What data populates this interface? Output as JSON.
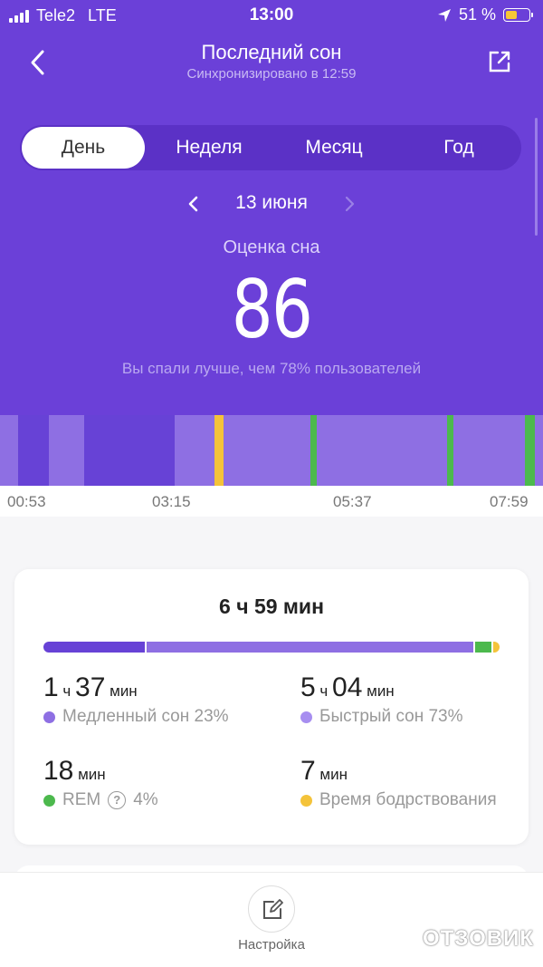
{
  "status_bar": {
    "carrier": "Tele2",
    "network": "LTE",
    "time": "13:00",
    "battery": "51 %"
  },
  "header": {
    "title": "Последний сон",
    "subtitle": "Синхронизировано в 12:59"
  },
  "tabs": [
    {
      "label": "День",
      "active": true
    },
    {
      "label": "Неделя",
      "active": false
    },
    {
      "label": "Месяц",
      "active": false
    },
    {
      "label": "Год",
      "active": false
    }
  ],
  "date_nav": {
    "label": "13 июня"
  },
  "score": {
    "label": "Оценка сна",
    "value": "86",
    "description": "Вы спали лучше, чем 78% пользователей"
  },
  "timeline": {
    "ticks": [
      "00:53",
      "03:15",
      "05:37",
      "07:59"
    ],
    "segments": [
      {
        "stage": "light",
        "start": 0.0,
        "end": 0.033
      },
      {
        "stage": "deep",
        "start": 0.033,
        "end": 0.09
      },
      {
        "stage": "light",
        "start": 0.09,
        "end": 0.155
      },
      {
        "stage": "deep",
        "start": 0.155,
        "end": 0.322
      },
      {
        "stage": "light",
        "start": 0.322,
        "end": 0.395
      },
      {
        "stage": "awake",
        "start": 0.395,
        "end": 0.412
      },
      {
        "stage": "light",
        "start": 0.412,
        "end": 0.572
      },
      {
        "stage": "rem",
        "start": 0.572,
        "end": 0.583
      },
      {
        "stage": "light",
        "start": 0.583,
        "end": 0.823
      },
      {
        "stage": "rem",
        "start": 0.823,
        "end": 0.835
      },
      {
        "stage": "light",
        "start": 0.835,
        "end": 0.967
      },
      {
        "stage": "rem",
        "start": 0.967,
        "end": 0.985
      },
      {
        "stage": "light",
        "start": 0.985,
        "end": 1.0
      }
    ]
  },
  "summary": {
    "total": "6 ч 59 мин",
    "bar": [
      {
        "stage": "deep",
        "fraction": 0.23
      },
      {
        "stage": "light",
        "fraction": 0.73
      },
      {
        "stage": "rem",
        "fraction": 0.04
      },
      {
        "stage": "awake",
        "fraction": 0.015
      }
    ],
    "deep": {
      "h": "1",
      "h_unit": "ч",
      "m": "37",
      "m_unit": "мин",
      "label": "Медленный сон 23%"
    },
    "light": {
      "h": "5",
      "h_unit": "ч",
      "m": "04",
      "m_unit": "мин",
      "label": "Быстрый сон 73%"
    },
    "rem": {
      "m": "18",
      "m_unit": "мин",
      "label": "REM",
      "percent": "4%",
      "help": "?"
    },
    "awake": {
      "m": "7",
      "m_unit": "мин",
      "label": "Время бодрствования"
    }
  },
  "colors": {
    "header": "#6b40d8",
    "deep": "#6742d6",
    "light": "#8e6fe3",
    "rem": "#4cb94d",
    "awake": "#f4c33a"
  },
  "bottom": {
    "settings_label": "Настройка"
  },
  "watermark": "ОТЗОВИК"
}
